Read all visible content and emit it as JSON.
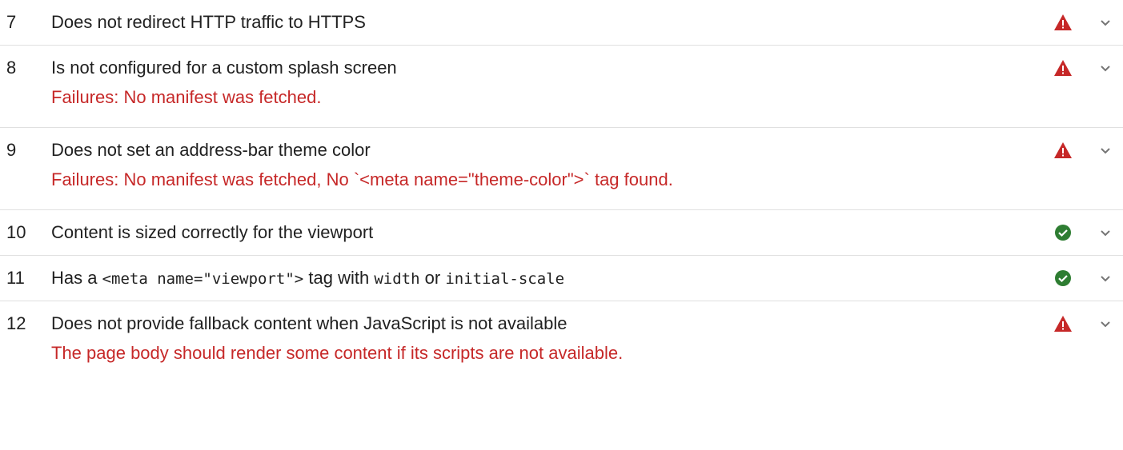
{
  "audits": [
    {
      "number": "7",
      "title": "Does not redirect HTTP traffic to HTTPS",
      "status": "fail",
      "status_icon": "warning-icon",
      "failure": ""
    },
    {
      "number": "8",
      "title": "Is not configured for a custom splash screen",
      "status": "fail",
      "status_icon": "warning-icon",
      "failure": "Failures: No manifest was fetched."
    },
    {
      "number": "9",
      "title": "Does not set an address-bar theme color",
      "status": "fail",
      "status_icon": "warning-icon",
      "failure": "Failures: No manifest was fetched, No `<meta name=\"theme-color\">` tag found."
    },
    {
      "number": "10",
      "title": "Content is sized correctly for the viewport",
      "status": "pass",
      "status_icon": "check-circle-icon",
      "failure": ""
    },
    {
      "number": "11",
      "title_parts": {
        "pre": "Has a ",
        "code1": "<meta name=\"viewport\">",
        "mid1": " tag with ",
        "code2": "width",
        "mid2": " or ",
        "code3": "initial-scale"
      },
      "status": "pass",
      "status_icon": "check-circle-icon",
      "failure": ""
    },
    {
      "number": "12",
      "title": "Does not provide fallback content when JavaScript is not available",
      "status": "fail",
      "status_icon": "warning-icon",
      "failure": "The page body should render some content if its scripts are not available."
    }
  ],
  "colors": {
    "fail": "#c62828",
    "pass": "#2e7d32",
    "text": "#212121",
    "divider": "#e0e0e0",
    "chevron": "#757575"
  },
  "expand_icon": "chevron-down-icon"
}
